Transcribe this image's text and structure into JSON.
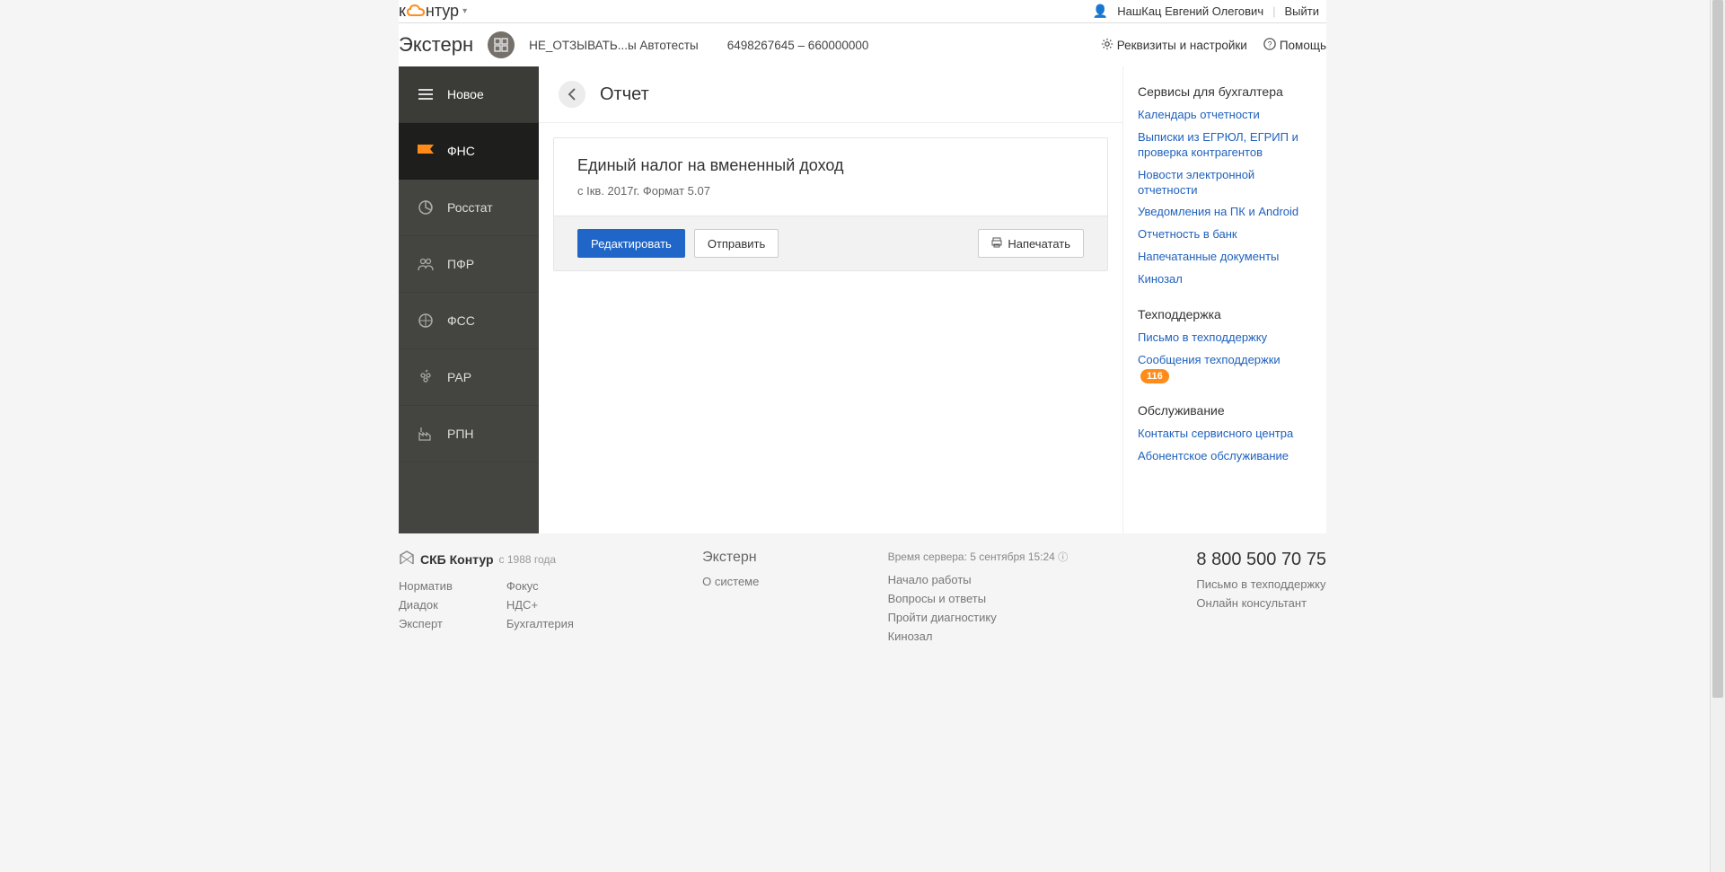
{
  "topbar": {
    "logo_prefix": "к",
    "logo_suffix": "нтур",
    "user_name": "НашКац Евгений Олегович",
    "logout": "Выйти"
  },
  "header": {
    "app_title": "Экстерн",
    "org_name": "НЕ_ОТЗЫВАТЬ...ы Автотесты",
    "org_id": "6498267645 – 660000000",
    "settings": "Реквизиты и настройки",
    "help": "Помощь"
  },
  "sidebar": {
    "items": [
      {
        "label": "Новое"
      },
      {
        "label": "ФНС"
      },
      {
        "label": "Росстат"
      },
      {
        "label": "ПФР"
      },
      {
        "label": "ФСС"
      },
      {
        "label": "РАР"
      },
      {
        "label": "РПН"
      }
    ]
  },
  "content": {
    "page_title": "Отчет",
    "report_title": "Единый налог на вмененный доход",
    "report_subtitle": "с Iкв. 2017г. Формат 5.07",
    "edit_btn": "Редактировать",
    "send_btn": "Отправить",
    "print_btn": "Напечатать"
  },
  "right_panel": {
    "section1_title": "Сервисы для бухгалтера",
    "links1": [
      "Календарь отчетности",
      "Выписки из ЕГРЮЛ, ЕГРИП и проверка контрагентов",
      "Новости электронной отчетности",
      "Уведомления на ПК и Android",
      "Отчетность в банк",
      "Напечатанные документы",
      "Кинозал"
    ],
    "section2_title": "Техподдержка",
    "support_letter": "Письмо в техподдержку",
    "support_msgs": "Сообщения техподдержки",
    "support_count": "116",
    "section3_title": "Обслуживание",
    "links3": [
      "Контакты сервисного центра",
      "Абонентское обслуживание"
    ]
  },
  "footer": {
    "brand": "СКБ Контур",
    "since": "с 1988 года",
    "col1_links": [
      "Норматив",
      "Диадок",
      "Эксперт"
    ],
    "col2_links": [
      "Фокус",
      "НДС+",
      "Бухгалтерия"
    ],
    "mid_title": "Экстерн",
    "mid_links": [
      "О системе"
    ],
    "server_time_label": "Время сервера: 5 сентября 15:24",
    "mid2_links": [
      "Начало работы",
      "Вопросы и ответы",
      "Пройти диагностику",
      "Кинозал"
    ],
    "phone": "8 800 500 70 75",
    "right_links": [
      "Письмо в техподдержку",
      "Онлайн консультант"
    ]
  }
}
